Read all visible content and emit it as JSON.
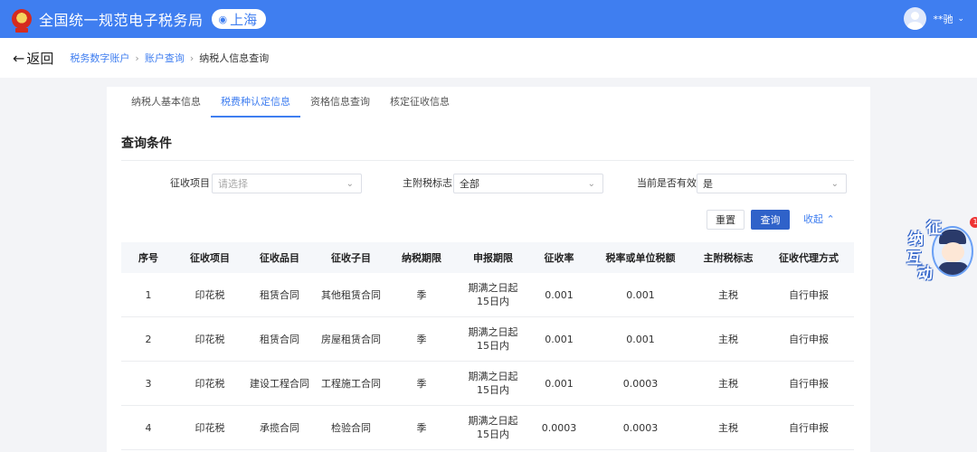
{
  "header": {
    "app_title": "全国统一规范电子税务局",
    "region": "上海",
    "region_icon": "map-pin-icon",
    "user_name": "**驰",
    "colors": {
      "bar": "#3f7ef0",
      "primary_button": "#2f62c9"
    }
  },
  "nav": {
    "back_label": "返回",
    "breadcrumb": [
      "税务数字账户",
      "账户查询",
      "纳税人信息查询"
    ]
  },
  "tabs": [
    {
      "label": "纳税人基本信息",
      "active": false
    },
    {
      "label": "税费种认定信息",
      "active": true
    },
    {
      "label": "资格信息查询",
      "active": false
    },
    {
      "label": "核定征收信息",
      "active": false
    }
  ],
  "query": {
    "title": "查询条件",
    "filters": [
      {
        "label": "征收项目",
        "value": "",
        "placeholder": "请选择"
      },
      {
        "label": "主附税标志",
        "value": "全部",
        "placeholder": ""
      },
      {
        "label": "当前是否有效",
        "value": "是",
        "placeholder": ""
      }
    ],
    "reset_label": "重置",
    "search_label": "查询",
    "collapse_label": "收起"
  },
  "table": {
    "columns": [
      "序号",
      "征收项目",
      "征收品目",
      "征收子目",
      "纳税期限",
      "申报期限",
      "征收率",
      "税率或单位税额",
      "主附税标志",
      "征收代理方式"
    ],
    "rows": [
      [
        "1",
        "印花税",
        "租赁合同",
        "其他租赁合同",
        "季",
        "期满之日起15日内",
        "0.001",
        "0.001",
        "主税",
        "自行申报"
      ],
      [
        "2",
        "印花税",
        "租赁合同",
        "房屋租赁合同",
        "季",
        "期满之日起15日内",
        "0.001",
        "0.001",
        "主税",
        "自行申报"
      ],
      [
        "3",
        "印花税",
        "建设工程合同",
        "工程施工合同",
        "季",
        "期满之日起15日内",
        "0.001",
        "0.0003",
        "主税",
        "自行申报"
      ],
      [
        "4",
        "印花税",
        "承揽合同",
        "检验合同",
        "季",
        "期满之日起15日内",
        "0.0003",
        "0.0003",
        "主税",
        "自行申报"
      ]
    ]
  },
  "widget": {
    "chars": [
      "征",
      "纳",
      "互",
      "动"
    ],
    "badge": "1"
  }
}
